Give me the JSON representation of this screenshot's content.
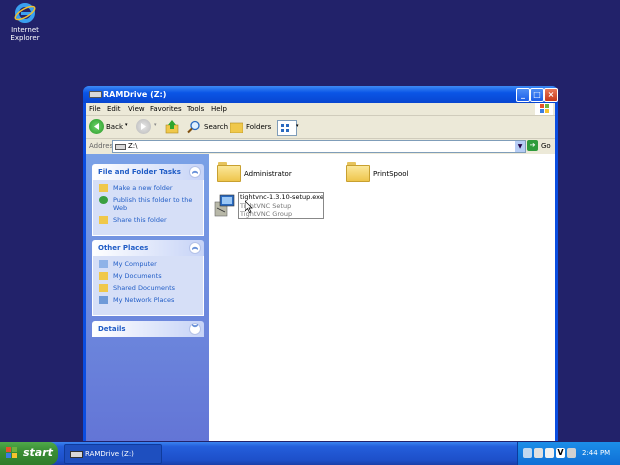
{
  "desktop": {
    "icons": [
      {
        "label": "Internet Explorer"
      }
    ]
  },
  "window": {
    "title": "RAMDrive (Z:)",
    "menu": [
      "File",
      "Edit",
      "View",
      "Favorites",
      "Tools",
      "Help"
    ],
    "toolbar": {
      "back": "Back",
      "search": "Search",
      "folders": "Folders"
    },
    "address": {
      "label": "Address",
      "value": "Z:\\",
      "go": "Go"
    },
    "tasks": {
      "file_folder": {
        "title": "File and Folder Tasks",
        "items": [
          "Make a new folder",
          "Publish this folder to the Web",
          "Share this folder"
        ]
      },
      "other_places": {
        "title": "Other Places",
        "items": [
          "My Computer",
          "My Documents",
          "Shared Documents",
          "My Network Places"
        ]
      },
      "details": {
        "title": "Details"
      }
    },
    "items": [
      {
        "name": "Administrator",
        "type": "folder"
      },
      {
        "name": "PrintSpool",
        "type": "folder"
      },
      {
        "name": "tightvnc-1.3.10-setup.exe",
        "line2": "TightVNC Setup",
        "line3": "TightVNC Group",
        "type": "exe"
      }
    ]
  },
  "taskbar": {
    "start": "start",
    "tasks": [
      "RAMDrive (Z:)"
    ],
    "clock": "2:44 PM"
  },
  "colors": {
    "taskbar": "#245edb",
    "start": "#3a8e34",
    "titlebar": "#0a55e6",
    "desktop": "#22226a"
  }
}
